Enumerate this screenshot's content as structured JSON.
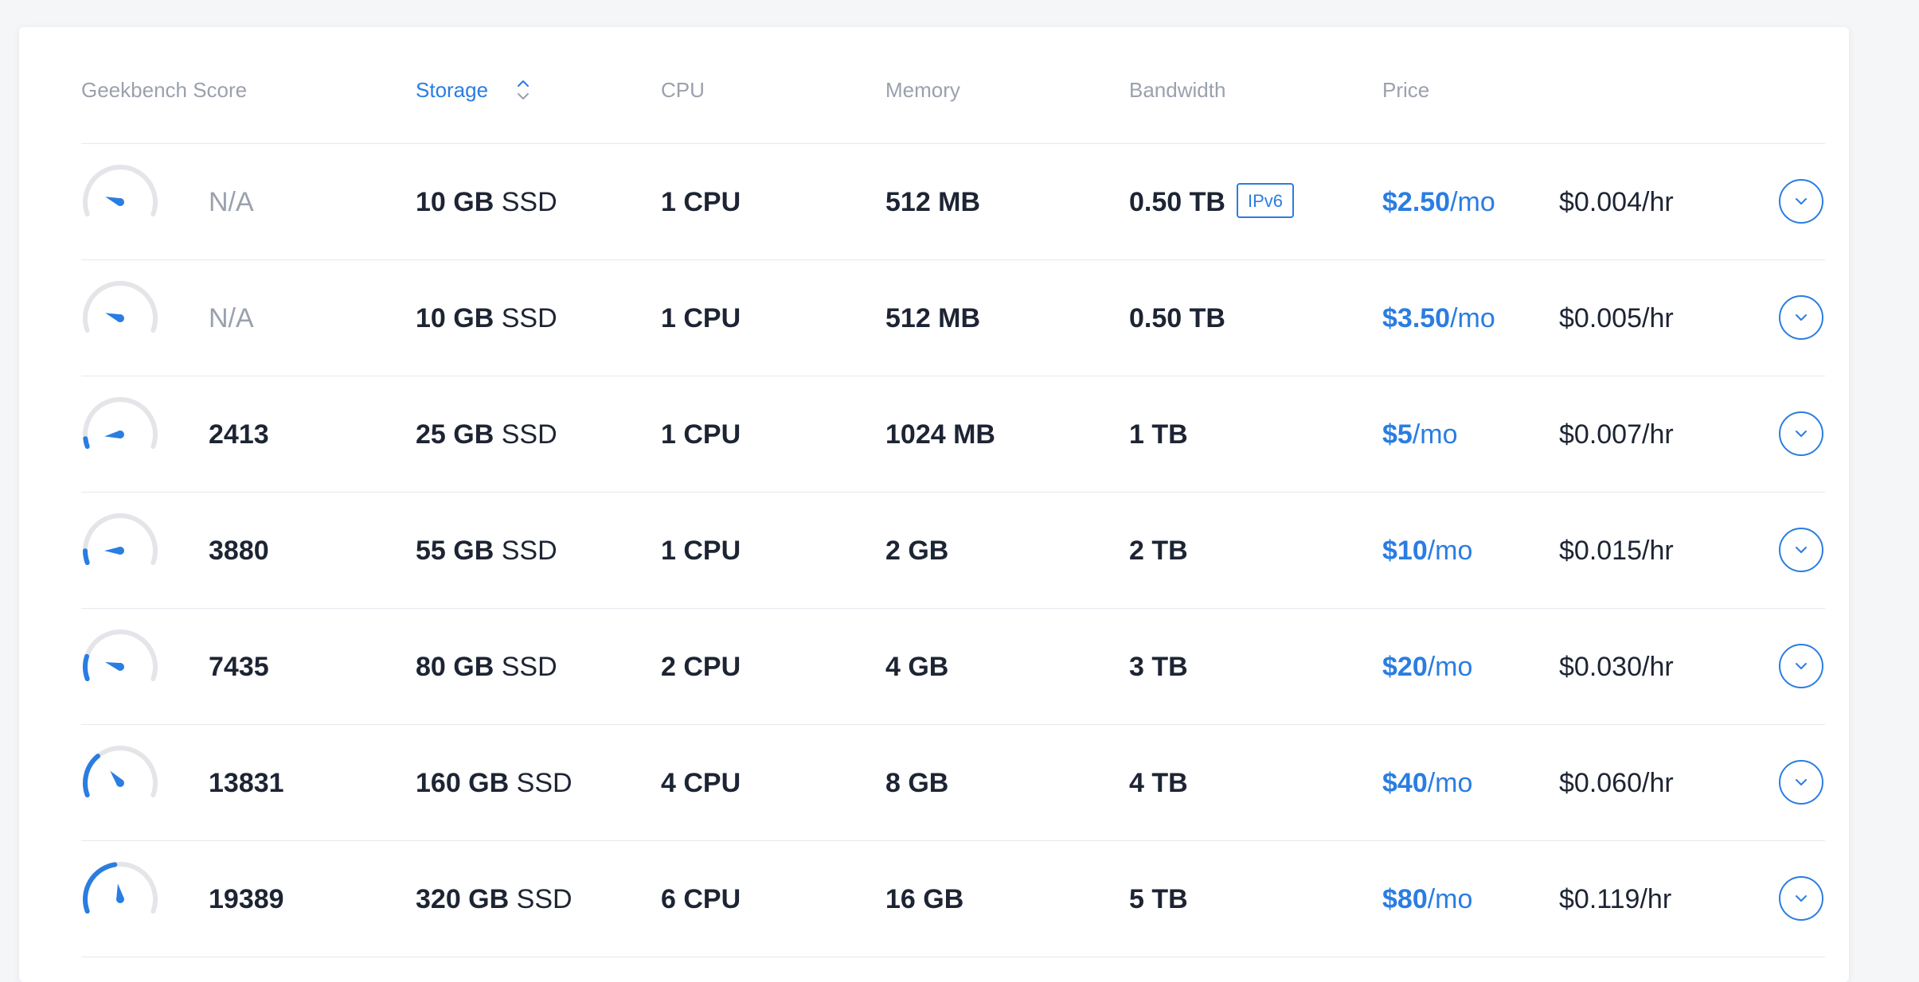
{
  "columns": {
    "geekbench": "Geekbench Score",
    "storage": "Storage",
    "cpu": "CPU",
    "memory": "Memory",
    "bandwidth": "Bandwidth",
    "price": "Price"
  },
  "sort": {
    "column": "Storage",
    "icon": "sort-updown-icon"
  },
  "colors": {
    "accent": "#2a7de1",
    "text": "#1d2433",
    "muted": "#9aa1ad",
    "gauge_track": "#e3e5e9"
  },
  "plans": [
    {
      "score": "N/A",
      "score_level": 0.18,
      "storage_size": "10 GB",
      "storage_type": "SSD",
      "cpu": "1 CPU",
      "memory": "512 MB",
      "bandwidth": "0.50 TB",
      "badge": "IPv6",
      "price_amount": "$2.50",
      "price_unit": "/mo",
      "hourly": "$0.004/hr"
    },
    {
      "score": "N/A",
      "score_level": 0.18,
      "storage_size": "10 GB",
      "storage_type": "SSD",
      "cpu": "1 CPU",
      "memory": "512 MB",
      "bandwidth": "0.50 TB",
      "badge": "",
      "price_amount": "$3.50",
      "price_unit": "/mo",
      "hourly": "$0.005/hr"
    },
    {
      "score": "2413",
      "score_level": 0.06,
      "storage_size": "25 GB",
      "storage_type": "SSD",
      "cpu": "1 CPU",
      "memory": "1024 MB",
      "bandwidth": "1 TB",
      "badge": "",
      "price_amount": "$5",
      "price_unit": "/mo",
      "hourly": "$0.007/hr"
    },
    {
      "score": "3880",
      "score_level": 0.09,
      "storage_size": "55 GB",
      "storage_type": "SSD",
      "cpu": "1 CPU",
      "memory": "2 GB",
      "bandwidth": "2 TB",
      "badge": "",
      "price_amount": "$10",
      "price_unit": "/mo",
      "hourly": "$0.015/hr"
    },
    {
      "score": "7435",
      "score_level": 0.17,
      "storage_size": "80 GB",
      "storage_type": "SSD",
      "cpu": "2 CPU",
      "memory": "4 GB",
      "bandwidth": "3 TB",
      "badge": "",
      "price_amount": "$20",
      "price_unit": "/mo",
      "hourly": "$0.030/hr"
    },
    {
      "score": "13831",
      "score_level": 0.32,
      "storage_size": "160 GB",
      "storage_type": "SSD",
      "cpu": "4 CPU",
      "memory": "8 GB",
      "bandwidth": "4 TB",
      "badge": "",
      "price_amount": "$40",
      "price_unit": "/mo",
      "hourly": "$0.060/hr"
    },
    {
      "score": "19389",
      "score_level": 0.46,
      "storage_size": "320 GB",
      "storage_type": "SSD",
      "cpu": "6 CPU",
      "memory": "16 GB",
      "bandwidth": "5 TB",
      "badge": "",
      "price_amount": "$80",
      "price_unit": "/mo",
      "hourly": "$0.119/hr"
    }
  ]
}
